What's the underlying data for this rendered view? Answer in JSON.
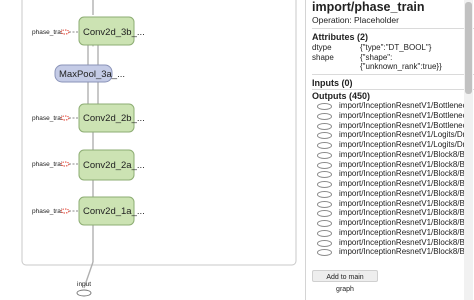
{
  "graph": {
    "nodes": {
      "conv_3b": "Conv2d_3b_...",
      "maxpool_3a": "MaxPool_3a_...",
      "conv_2b": "Conv2d_2b_...",
      "conv_2a": "Conv2d_2a_...",
      "conv_1a": "Conv2d_1a_..."
    },
    "phase_train_label": "phase_train",
    "input_label": "input"
  },
  "panel": {
    "title": "import/phase_train",
    "operation": "Operation: Placeholder",
    "attributes_heading": "Attributes (2)",
    "attributes": [
      {
        "key": "dtype",
        "value": "{\"type\":\"DT_BOOL\"}"
      },
      {
        "key": "shape",
        "value": "{\"shape\":",
        "value2": "{\"unknown_rank\":true}}"
      }
    ],
    "inputs_heading": "Inputs (0)",
    "outputs_heading": "Outputs (450)",
    "outputs": [
      "import/InceptionResnetV1/Bottleneck",
      "import/InceptionResnetV1/Bottleneck",
      "import/InceptionResnetV1/Bottleneck",
      "import/InceptionResnetV1/Logits/Dro",
      "import/InceptionResnetV1/Logits/Dro",
      "import/InceptionResnetV1/Block8/Bra",
      "import/InceptionResnetV1/Block8/Bra",
      "import/InceptionResnetV1/Block8/Bra",
      "import/InceptionResnetV1/Block8/Bra",
      "import/InceptionResnetV1/Block8/Bra",
      "import/InceptionResnetV1/Block8/Bra",
      "import/InceptionResnetV1/Block8/Bra",
      "import/InceptionResnetV1/Block8/Bra",
      "import/InceptionResnetV1/Block8/Bra",
      "import/InceptionResnetV1/Block8/Bra",
      "import/InceptionResnetV1/Block8/Bra"
    ],
    "add_button": "Add to main graph"
  }
}
